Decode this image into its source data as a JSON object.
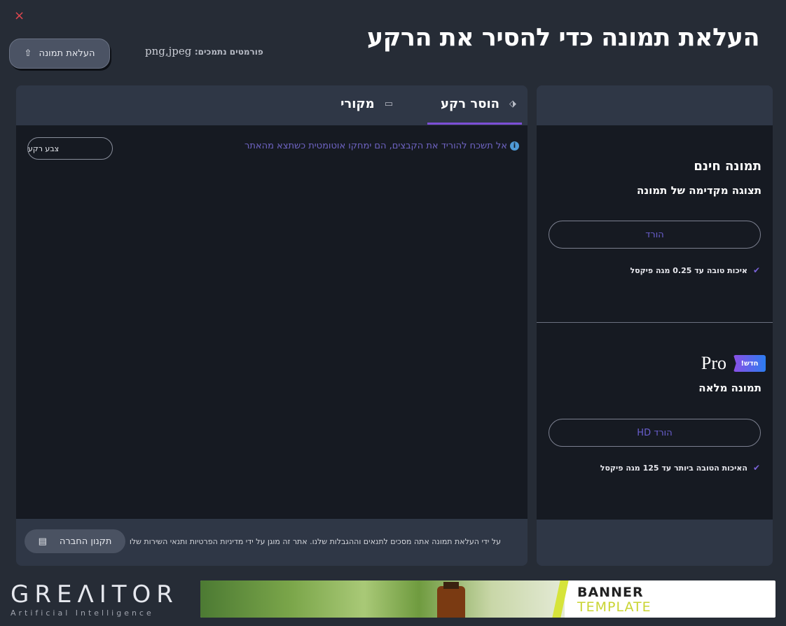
{
  "window": {
    "close_icon": "×"
  },
  "header": {
    "title": "העלאת תמונה כדי להסיר את הרקע",
    "upload_button": "העלאת תמונה",
    "upload_icon": "⇧",
    "formats_label": "פורמטים נתמכים:",
    "formats_value": "png,jpeg"
  },
  "editor": {
    "tabs": [
      {
        "label": "הוסר רקע",
        "icon": "⬗"
      },
      {
        "label": "מקורי",
        "icon": "▭"
      }
    ],
    "notice": "אל תשכח להוריד את הקבצים, הם ימחקו אוטומטית כשתצא מהאתר",
    "notice_icon": "i",
    "bg_color_button": "צבע רקע",
    "terms_text": "על ידי העלאת תמונה אתה מסכים לתנאים וההגבלות שלנו. אתר זה מוגן על ידי מדיניות הפרטיות ותנאי השירות שלו",
    "rules_button": "תקנון החברה",
    "rules_icon": "▤"
  },
  "plans": {
    "free": {
      "title": "תמונה חינם",
      "subtitle": "תצוגה מקדימה של תמונה",
      "button": "הורד",
      "feature": "איכות טובה עד 0.25 מגה פיקסל"
    },
    "pro": {
      "badge": "חדש!",
      "label": "Pro",
      "subtitle": "תמונה מלאה",
      "button": "הורד HD",
      "feature": "האיכות הטובה ביותר עד 125 מגה פיקסל"
    },
    "check_icon": "✔"
  },
  "brand": {
    "logo_text_1": "GRE",
    "logo_text_ai": "ΛI",
    "logo_text_2": "TOR",
    "logo_sub": "Artificial Intelligence"
  },
  "banner": {
    "line1": "BANNER",
    "line2": "TEMPLATE"
  }
}
